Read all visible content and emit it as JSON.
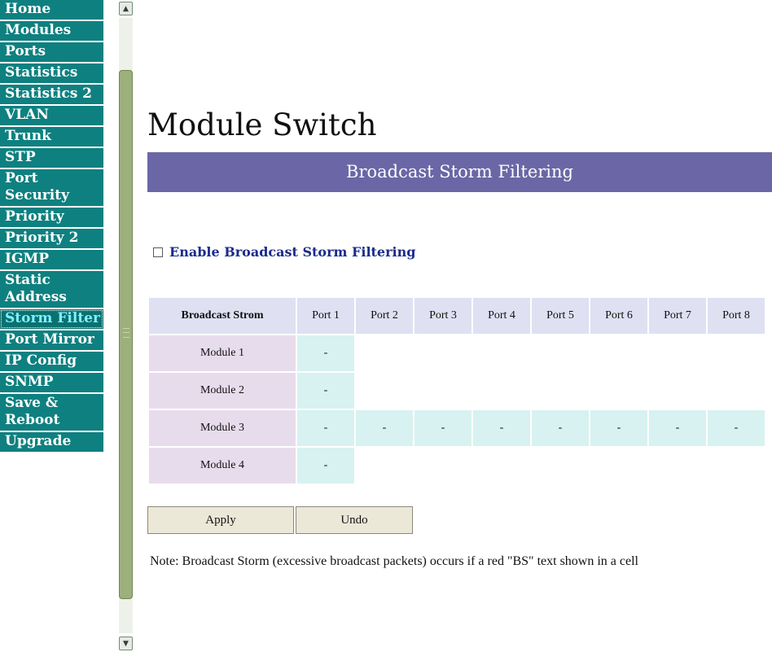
{
  "nav": {
    "items": [
      {
        "label": "Home",
        "lines": [
          "Home"
        ]
      },
      {
        "label": "Modules",
        "lines": [
          "Modules"
        ]
      },
      {
        "label": "Ports",
        "lines": [
          "Ports"
        ]
      },
      {
        "label": "Statistics",
        "lines": [
          "Statistics"
        ]
      },
      {
        "label": "Statistics 2",
        "lines": [
          "Statistics 2"
        ]
      },
      {
        "label": "VLAN",
        "lines": [
          "VLAN"
        ]
      },
      {
        "label": "Trunk",
        "lines": [
          "Trunk"
        ]
      },
      {
        "label": "STP",
        "lines": [
          "STP"
        ]
      },
      {
        "label": "Port Security",
        "lines": [
          "Port",
          "Security"
        ]
      },
      {
        "label": "Priority",
        "lines": [
          "Priority"
        ]
      },
      {
        "label": "Priority 2",
        "lines": [
          "Priority 2"
        ]
      },
      {
        "label": "IGMP",
        "lines": [
          "IGMP"
        ]
      },
      {
        "label": "Static Address",
        "lines": [
          "Static",
          "Address"
        ]
      },
      {
        "label": "Storm Filter",
        "lines": [
          "Storm Filter"
        ],
        "active": true
      },
      {
        "label": "Port Mirror",
        "lines": [
          "Port Mirror"
        ]
      },
      {
        "label": "IP Config",
        "lines": [
          "IP Config"
        ]
      },
      {
        "label": "SNMP",
        "lines": [
          "SNMP"
        ]
      },
      {
        "label": "Save & Reboot",
        "lines": [
          "Save &",
          "Reboot"
        ]
      },
      {
        "label": "Upgrade",
        "lines": [
          "Upgrade"
        ]
      }
    ]
  },
  "scrollbar": {
    "up_icon": "scroll-up-icon",
    "down_icon": "scroll-down-icon"
  },
  "page": {
    "title": "Module Switch",
    "section_title": "Broadcast Storm Filtering",
    "enable_label": "Enable Broadcast Storm Filtering",
    "enable_checked": false
  },
  "table": {
    "header_main": "Broadcast Strom",
    "ports": [
      "Port 1",
      "Port 2",
      "Port 3",
      "Port 4",
      "Port 5",
      "Port 6",
      "Port 7",
      "Port 8"
    ],
    "rows": [
      {
        "module": "Module 1",
        "cells": [
          "-",
          "",
          "",
          "",
          "",
          "",
          "",
          ""
        ]
      },
      {
        "module": "Module 2",
        "cells": [
          "-",
          "",
          "",
          "",
          "",
          "",
          "",
          ""
        ]
      },
      {
        "module": "Module 3",
        "cells": [
          "-",
          "-",
          "-",
          "-",
          "-",
          "-",
          "-",
          "-"
        ]
      },
      {
        "module": "Module 4",
        "cells": [
          "-",
          "",
          "",
          "",
          "",
          "",
          "",
          ""
        ]
      }
    ]
  },
  "buttons": {
    "apply": "Apply",
    "undo": "Undo"
  },
  "note": "Note: Broadcast Storm (excessive broadcast packets) occurs if a red \"BS\" text shown in a cell",
  "colors": {
    "nav_bg": "#0f8080",
    "section_bar": "#6b67a6",
    "header_text": "#1a2b8a"
  }
}
